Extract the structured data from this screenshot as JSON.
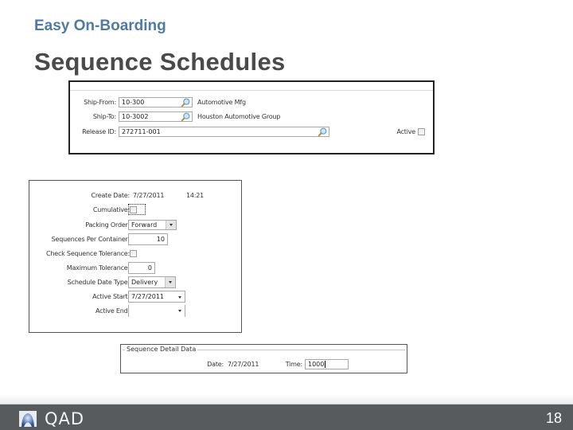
{
  "header": {
    "subtitle": "Easy On-Boarding",
    "title": "Sequence Schedules"
  },
  "top_form": {
    "ship_from": {
      "label": "Ship-From:",
      "value": "10-300",
      "description": "Automotive Mfg",
      "icon": "search-icon"
    },
    "ship_to": {
      "label": "Ship-To:",
      "value": "10-3002",
      "description": "Houston Automotive Group",
      "icon": "search-icon"
    },
    "release_id": {
      "label": "Release ID:",
      "value": "272711-001",
      "icon": "search-icon"
    },
    "active": {
      "label": "Active",
      "checked": false
    }
  },
  "detail_form": {
    "create_date": {
      "label": "Create Date:",
      "value": "7/27/2011",
      "time": "14:21"
    },
    "cumulative": {
      "label": "Cumulative:",
      "checked": false
    },
    "packing_order": {
      "label": "Packing Order:",
      "value": "Forward"
    },
    "sequences_per_container": {
      "label": "Sequences Per Container:",
      "value": "10"
    },
    "check_sequence_tolerance": {
      "label": "Check Sequence Tolerance:",
      "checked": false
    },
    "maximum_tolerance": {
      "label": "Maximum Tolerance:",
      "value": "0"
    },
    "schedule_date_type": {
      "label": "Schedule Date Type:",
      "value": "Delivery"
    },
    "active_start": {
      "label": "Active Start:",
      "value": "7/27/2011"
    },
    "active_end": {
      "label": "Active End:",
      "value": ""
    }
  },
  "sequence_detail": {
    "legend": "Sequence Detail Data",
    "date": {
      "label": "Date:",
      "value": "7/27/2011"
    },
    "time": {
      "label": "Time:",
      "value": "1000"
    }
  },
  "footer": {
    "logo_text": "QAD",
    "page_number": "18"
  }
}
